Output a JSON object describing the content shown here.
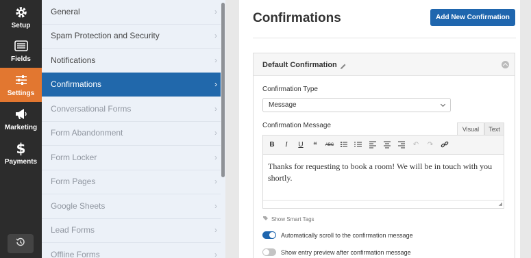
{
  "rail": {
    "items": [
      {
        "label": "Setup",
        "icon": "gear-icon"
      },
      {
        "label": "Fields",
        "icon": "fields-list-icon"
      },
      {
        "label": "Settings",
        "icon": "sliders-icon",
        "active": true
      },
      {
        "label": "Marketing",
        "icon": "megaphone-icon"
      },
      {
        "label": "Payments",
        "icon": "dollar-icon"
      }
    ],
    "history_icon": "history-icon",
    "active_color": "#e27730"
  },
  "settings_panel": {
    "items": [
      {
        "label": "General"
      },
      {
        "label": "Spam Protection and Security"
      },
      {
        "label": "Notifications"
      },
      {
        "label": "Confirmations",
        "active": true
      },
      {
        "label": "Conversational Forms"
      },
      {
        "label": "Form Abandonment"
      },
      {
        "label": "Form Locker"
      },
      {
        "label": "Form Pages"
      },
      {
        "label": "Google Sheets"
      },
      {
        "label": "Lead Forms"
      },
      {
        "label": "Offline Forms"
      }
    ],
    "active_color": "#2168ab"
  },
  "main": {
    "title": "Confirmations",
    "add_button": "Add New Confirmation",
    "confirmation": {
      "title": "Default Confirmation",
      "type_label": "Confirmation Type",
      "type_value": "Message",
      "message_label": "Confirmation Message",
      "tabs": {
        "visual": "Visual",
        "text": "Text"
      },
      "message_text": "Thanks for requesting to book a room! We will be in touch with you shortly.",
      "smart_tags": "Show Smart Tags",
      "toggles": [
        {
          "label": "Automatically scroll to the confirmation message",
          "on": true
        },
        {
          "label": "Show entry preview after confirmation message",
          "on": false
        }
      ]
    },
    "accent_color": "#1f66ae"
  }
}
